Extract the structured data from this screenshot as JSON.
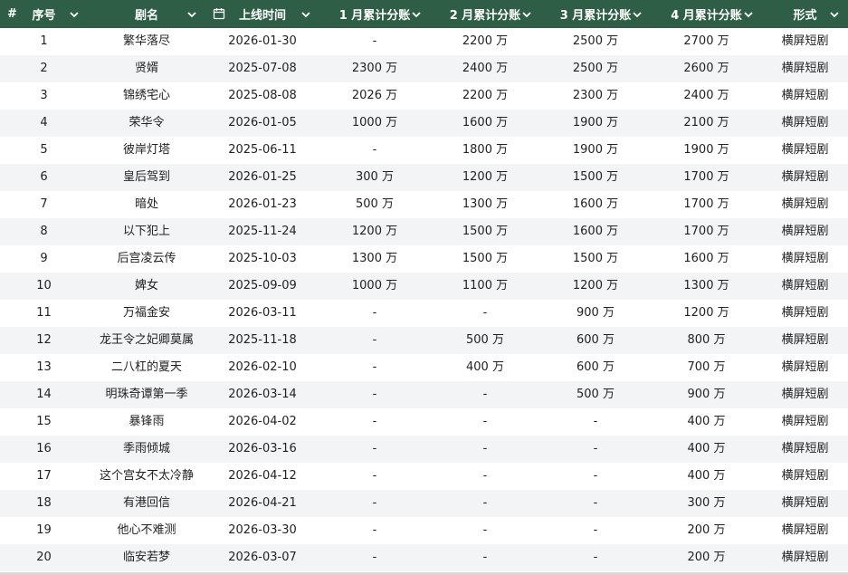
{
  "header": {
    "hash": "#",
    "columns": [
      "序号",
      "剧名",
      "上线时间",
      "1 月累计分账",
      "2 月累计分账",
      "3 月累计分账",
      "4 月累计分账",
      "形式"
    ]
  },
  "colors": {
    "header_bg": "#2f5e46",
    "alt_row": "#f3f4f6"
  },
  "rows": [
    [
      "1",
      "繁华落尽",
      "2026-01-30",
      "-",
      "2200 万",
      "2500 万",
      "2700 万",
      "横屏短剧"
    ],
    [
      "2",
      "贤婿",
      "2025-07-08",
      "2300 万",
      "2400 万",
      "2500 万",
      "2600 万",
      "横屏短剧"
    ],
    [
      "3",
      "锦绣宅心",
      "2025-08-08",
      "2026 万",
      "2200 万",
      "2300 万",
      "2400 万",
      "横屏短剧"
    ],
    [
      "4",
      "荣华令",
      "2026-01-05",
      "1000 万",
      "1600 万",
      "1900 万",
      "2100 万",
      "横屏短剧"
    ],
    [
      "5",
      "彼岸灯塔",
      "2025-06-11",
      "-",
      "1800 万",
      "1900 万",
      "1900 万",
      "横屏短剧"
    ],
    [
      "6",
      "皇后驾到",
      "2026-01-25",
      "300 万",
      "1200 万",
      "1500 万",
      "1700 万",
      "横屏短剧"
    ],
    [
      "7",
      "暗处",
      "2026-01-23",
      "500 万",
      "1300 万",
      "1600 万",
      "1700 万",
      "横屏短剧"
    ],
    [
      "8",
      "以下犯上",
      "2025-11-24",
      "1200 万",
      "1500 万",
      "1600 万",
      "1700 万",
      "横屏短剧"
    ],
    [
      "9",
      "后宫凌云传",
      "2025-10-03",
      "1300 万",
      "1500 万",
      "1500 万",
      "1600 万",
      "横屏短剧"
    ],
    [
      "10",
      "婢女",
      "2025-09-09",
      "1000 万",
      "1100 万",
      "1200 万",
      "1300 万",
      "横屏短剧"
    ],
    [
      "11",
      "万福金安",
      "2026-03-11",
      "-",
      "-",
      "900 万",
      "1200 万",
      "横屏短剧"
    ],
    [
      "12",
      "龙王令之妃卿莫属",
      "2025-11-18",
      "-",
      "500 万",
      "600 万",
      "800 万",
      "横屏短剧"
    ],
    [
      "13",
      "二八杠的夏天",
      "2026-02-10",
      "-",
      "400 万",
      "600 万",
      "700 万",
      "横屏短剧"
    ],
    [
      "14",
      "明珠奇谭第一季",
      "2026-03-14",
      "-",
      "-",
      "500 万",
      "900 万",
      "横屏短剧"
    ],
    [
      "15",
      "暴锋雨",
      "2026-04-02",
      "-",
      "-",
      "-",
      "400 万",
      "横屏短剧"
    ],
    [
      "16",
      "季雨倾城",
      "2026-03-16",
      "-",
      "-",
      "-",
      "400 万",
      "横屏短剧"
    ],
    [
      "17",
      "这个宫女不太冷静",
      "2026-04-12",
      "-",
      "-",
      "-",
      "400 万",
      "横屏短剧"
    ],
    [
      "18",
      "有港回信",
      "2026-04-21",
      "-",
      "-",
      "-",
      "300 万",
      "横屏短剧"
    ],
    [
      "19",
      "他心不难测",
      "2026-03-30",
      "-",
      "-",
      "-",
      "200 万",
      "横屏短剧"
    ],
    [
      "20",
      "临安若梦",
      "2026-03-07",
      "-",
      "-",
      "-",
      "200 万",
      "横屏短剧"
    ]
  ]
}
